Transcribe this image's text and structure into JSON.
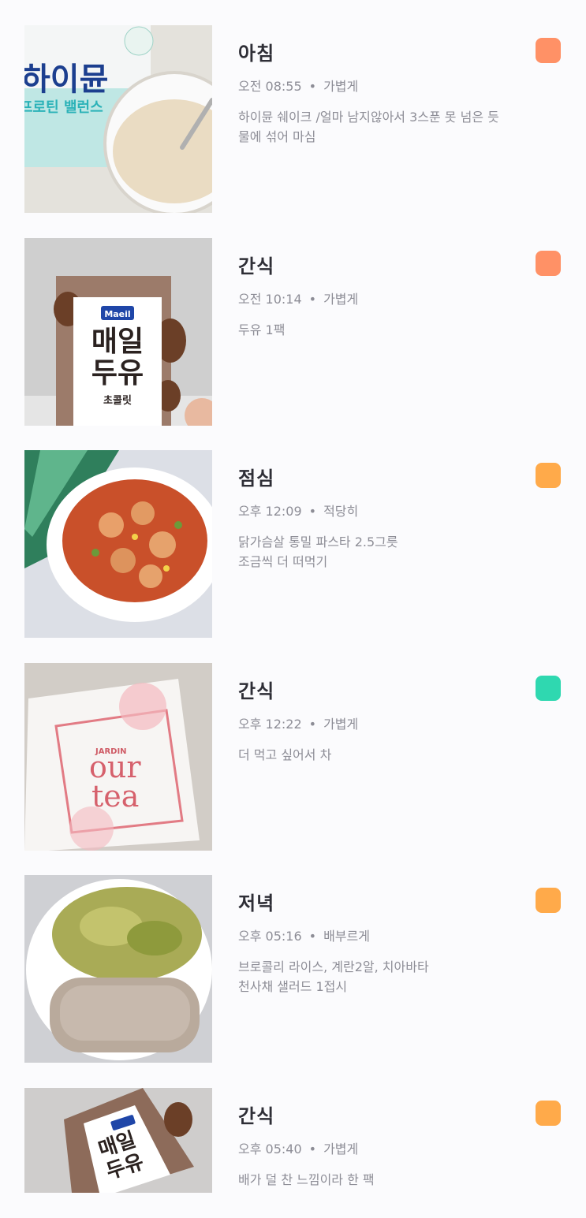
{
  "meals": [
    {
      "title": "아침",
      "time": "오전 08:55",
      "fullness": "가볍게",
      "note_lines": [
        "하이뮨 쉐이크 /얼마 남지않아서 3스푼 못 넘은 듯",
        "물에 섞어 마심"
      ],
      "badge_color": "#ff9166",
      "photo": "protein-shake-photo"
    },
    {
      "title": "간식",
      "time": "오전 10:14",
      "fullness": "가볍게",
      "note_lines": [
        "두유 1팩"
      ],
      "badge_color": "#ff9166",
      "photo": "soy-milk-carton-photo"
    },
    {
      "title": "점심",
      "time": "오후 12:09",
      "fullness": "적당히",
      "note_lines": [
        "닭가슴살 통밀 파스타 2.5그릇",
        "조금씩 더 떠먹기"
      ],
      "badge_color": "#ffaa4a",
      "photo": "chicken-pasta-photo"
    },
    {
      "title": "간식",
      "time": "오후 12:22",
      "fullness": "가볍게",
      "note_lines": [
        "더 먹고 싶어서 차"
      ],
      "badge_color": "#2fd8b0",
      "photo": "tea-bag-photo"
    },
    {
      "title": "저녁",
      "time": "오후 05:16",
      "fullness": "배부르게",
      "note_lines": [
        "브로콜리 라이스, 계란2알, 치아바타",
        "천사채 샐러드 1접시"
      ],
      "badge_color": "#ffaa4a",
      "photo": "broccoli-rice-bread-photo"
    },
    {
      "title": "간식",
      "time": "오후 05:40",
      "fullness": "가볍게",
      "note_lines": [
        "배가 덜 찬 느낌이라 한 팩"
      ],
      "badge_color": "#ffaa4a",
      "photo": "soy-milk-carton-photo"
    }
  ],
  "photo_text": {
    "shake_brand": "하이뮨",
    "shake_sub": "프로틴 밸런스",
    "milk_brand": "Maeil",
    "milk_line1": "매일",
    "milk_line2": "두유",
    "milk_flavor": "초콜릿",
    "tea_brand": "JARDIN",
    "tea_line1": "our",
    "tea_line2": "tea"
  }
}
